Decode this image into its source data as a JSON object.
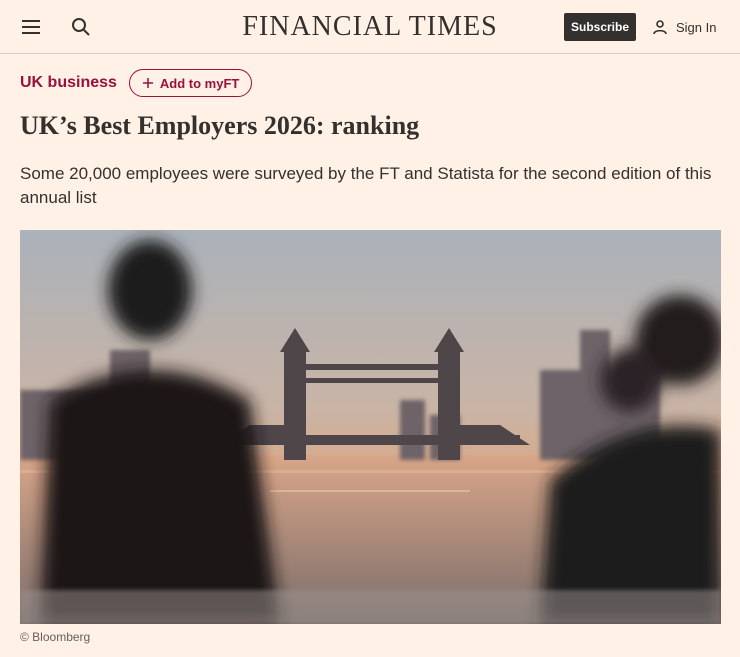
{
  "header": {
    "brand": "FINANCIAL TIMES",
    "subscribe_label": "Subscribe",
    "signin_label": "Sign In",
    "menu_icon": "hamburger-menu-icon",
    "search_icon": "search-icon",
    "user_icon": "user-icon"
  },
  "topic": {
    "label": "UK business",
    "myft_label": "Add to myFT",
    "myft_icon": "plus-icon"
  },
  "article": {
    "headline": "UK’s Best Employers 2026: ranking",
    "standfirst": "Some 20,000 employees were surveyed by the FT and Statista for the second edition of this annual list",
    "image_caption": "© Bloomberg"
  },
  "colors": {
    "background": "#fff1e5",
    "text": "#33302e",
    "accent": "#990f3d"
  }
}
